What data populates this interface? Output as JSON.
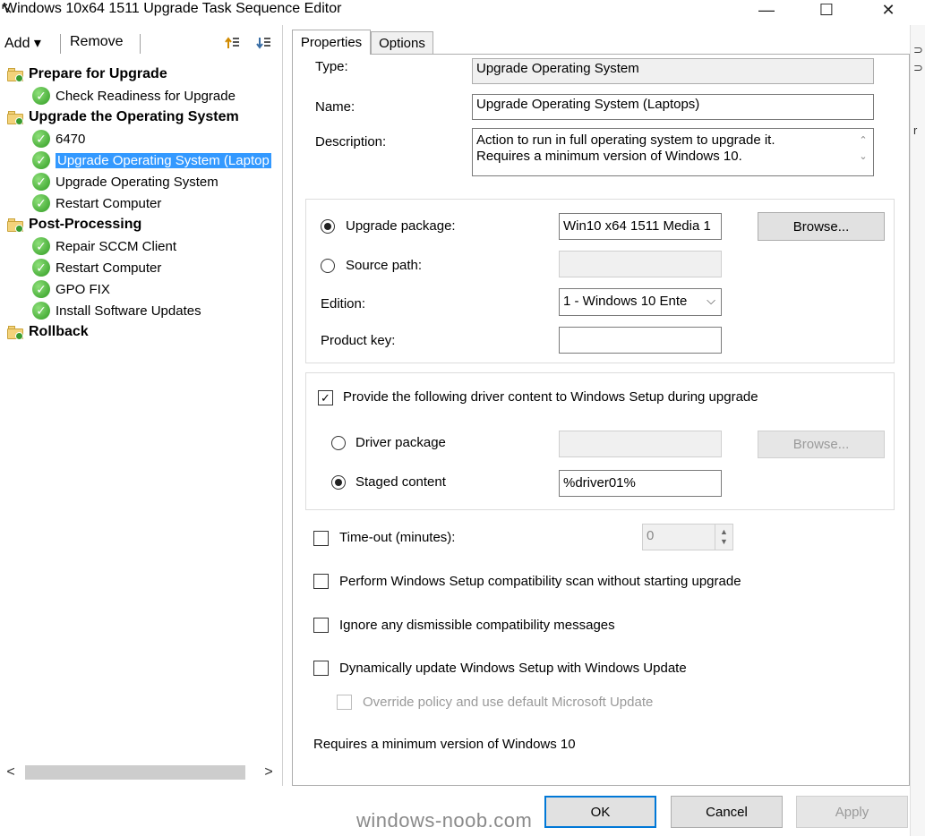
{
  "window": {
    "title": "Windows 10x64 1511 Upgrade Task Sequence Editor",
    "controls": {
      "minimize": "—",
      "maximize": "☐",
      "close": "✕"
    }
  },
  "toolbar": {
    "add_label": "Add ▾",
    "remove_label": "Remove",
    "icons": [
      "move-up-icon",
      "move-down-icon"
    ]
  },
  "tree": {
    "groups": [
      {
        "label": "Prepare for Upgrade",
        "steps": [
          "Check Readiness for Upgrade"
        ]
      },
      {
        "label": "Upgrade the Operating System",
        "steps": [
          "6470",
          "Upgrade Operating System (Laptop",
          "Upgrade Operating System",
          "Restart Computer"
        ]
      },
      {
        "label": "Post-Processing",
        "steps": [
          "Repair SCCM Client",
          "Restart Computer",
          "GPO FIX",
          "Install Software Updates"
        ]
      },
      {
        "label": "Rollback",
        "steps": []
      }
    ],
    "selected_step": "Upgrade Operating System (Laptop"
  },
  "tabs": {
    "properties": "Properties",
    "options": "Options",
    "active": "Properties"
  },
  "properties": {
    "type_label": "Type:",
    "type_value": "Upgrade Operating System",
    "name_label": "Name:",
    "name_value": "Upgrade Operating System (Laptops)",
    "description_label": "Description:",
    "description_line1": "Action to run in full operating system to upgrade it.",
    "description_line2": "Requires a minimum version of Windows 10.",
    "upgrade_package_label": "Upgrade package:",
    "upgrade_package_value": "Win10 x64 1511 Media 1",
    "upgrade_package_selected": true,
    "browse_label": "Browse...",
    "source_path_label": "Source path:",
    "source_path_value": "",
    "edition_label": "Edition:",
    "edition_value": "1 - Windows 10 Ente",
    "product_key_label": "Product key:",
    "product_key_value": "",
    "driver_content_label": "Provide the following driver content to Windows Setup during upgrade",
    "driver_content_checked": true,
    "driver_package_label": "Driver package",
    "driver_package_value": "",
    "driver_browse_label": "Browse...",
    "staged_content_label": "Staged content",
    "staged_content_value": "%driver01%",
    "staged_content_selected": true,
    "timeout_label": "Time-out (minutes):",
    "timeout_value": "0",
    "compat_scan_label": "Perform Windows Setup compatibility scan without starting upgrade",
    "ignore_messages_label": "Ignore any dismissible compatibility messages",
    "dynamic_update_label": "Dynamically update Windows Setup with Windows Update",
    "override_policy_label": "Override policy and use default Microsoft Update",
    "requirement_note": "Requires a minimum version of Windows 10"
  },
  "dialog_buttons": {
    "ok": "OK",
    "cancel": "Cancel",
    "apply": "Apply"
  },
  "watermark": "windows-noob.com",
  "colors": {
    "selection": "#3399ff",
    "default_button_border": "#0078d7",
    "check_green": "#2f9b21"
  }
}
